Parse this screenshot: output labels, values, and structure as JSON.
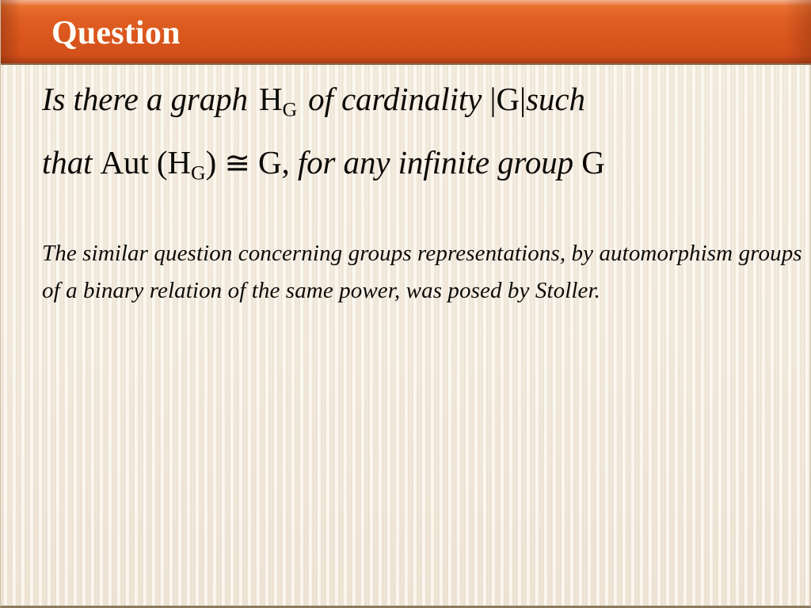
{
  "slide": {
    "title": "Question",
    "banner_color_top": "#eb7b45",
    "banner_color_bottom": "#c6491a",
    "background_color": "#f1e9da",
    "text_color": "#0d0b08"
  },
  "main_statement": {
    "line1_part1": "Is there a graph",
    "line1_symbol_base": "H",
    "line1_symbol_sub": "G",
    "line1_part2": "of cardinality",
    "line1_bar_open": "|",
    "line1_group": "G",
    "line1_bar_close": "|",
    "line1_part3": "such",
    "line2_part1": "that",
    "line2_aut": "Aut (",
    "line2_symbol_base": "H",
    "line2_symbol_sub": "G",
    "line2_aut_close": ")",
    "line2_cong": "≅",
    "line2_group": "G,",
    "line2_part2": "for any infinite group",
    "line2_group_end": "G"
  },
  "secondary_paragraph": {
    "text": "The similar question concerning groups representations, by automorphism groups of a binary relation of the same power, was posed by Stoller."
  }
}
